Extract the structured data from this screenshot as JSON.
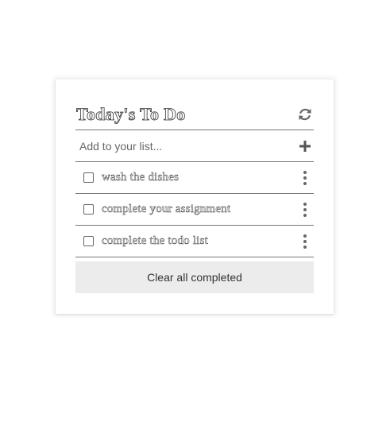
{
  "app": {
    "title": "Today's To Do",
    "add_placeholder": "Add to your list...",
    "todos": [
      {
        "label": "wash the dishes",
        "checked": false
      },
      {
        "label": "complete your assignment",
        "checked": false
      },
      {
        "label": "complete the todo list",
        "checked": false
      }
    ],
    "clear_label": "Clear all completed",
    "icons": {
      "refresh": "refresh-icon",
      "add": "plus-icon",
      "menu": "kebab-menu-icon"
    },
    "colors": {
      "icon": "#666666",
      "divider": "#777777",
      "clear_button_bg": "#ececec"
    }
  }
}
